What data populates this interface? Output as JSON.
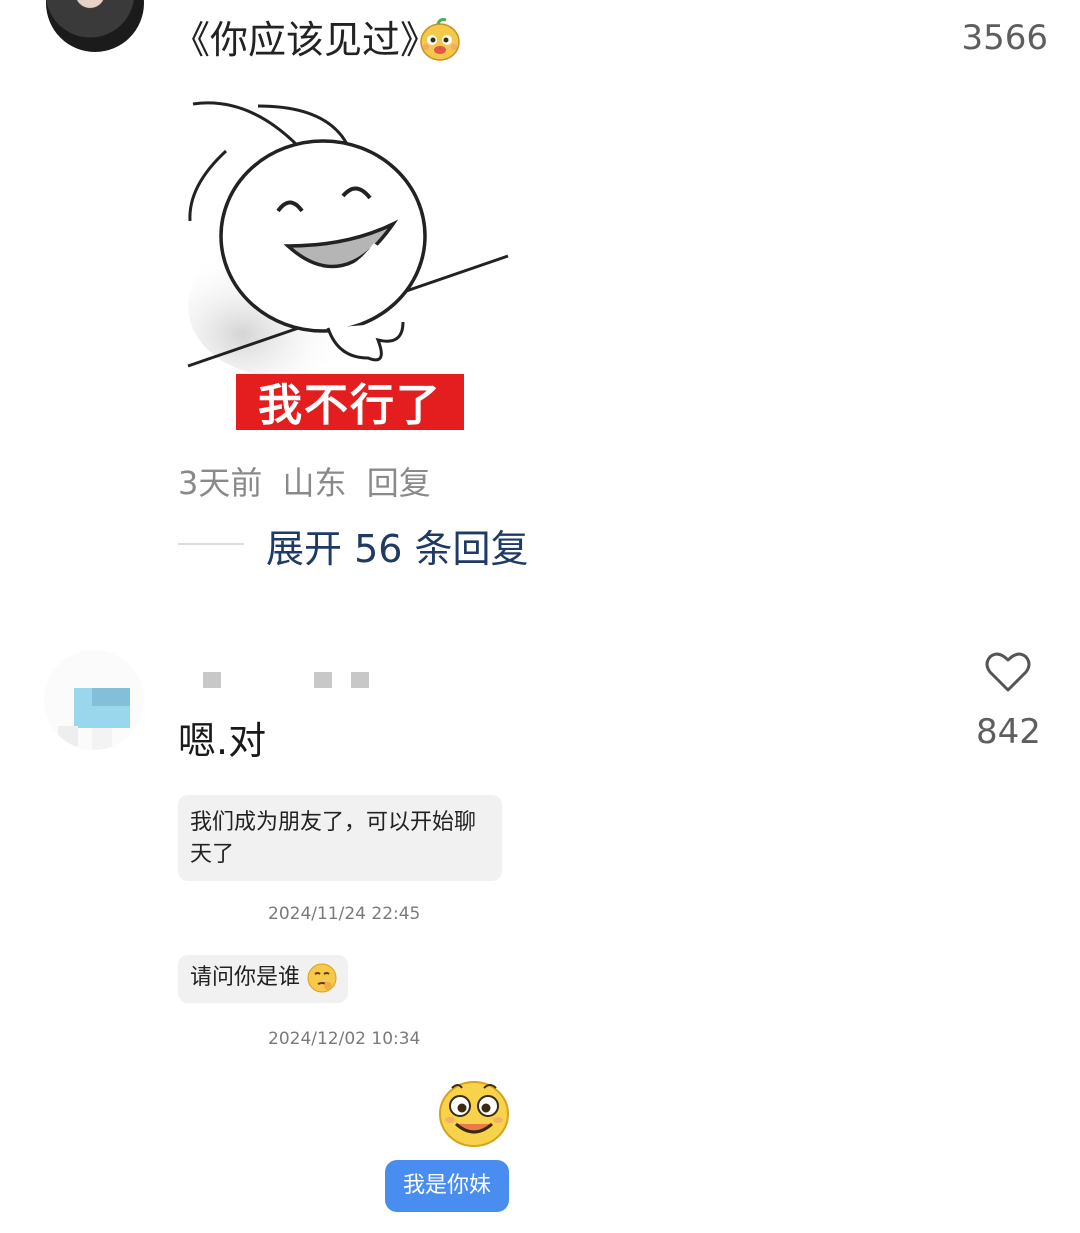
{
  "comment1": {
    "text": "《你应该见过》",
    "emoji_icon": "gourd-face-emoji-icon",
    "like_count": "3566",
    "meme_caption": "我不行了",
    "time": "3天前",
    "location": "山东",
    "reply_label": "回复",
    "expand_label": "展开 56 条回复"
  },
  "comment2": {
    "text": "嗯.对",
    "like_count": "842",
    "like_icon": "heart-outline-icon"
  },
  "chat": {
    "message1": "我们成为朋友了，可以开始聊天了",
    "timestamp1": "2024/11/24 22:45",
    "message2": "请问你是谁",
    "timestamp2": "2024/12/02 10:34",
    "reply_emoji": "smiling-face-emoji-icon",
    "reply_message": "我是你妹"
  },
  "colors": {
    "link": "#1f3b63",
    "meta_gray": "#8a8a8a",
    "chat_blue": "#4a8df0",
    "meme_red": "#e41e1e"
  }
}
